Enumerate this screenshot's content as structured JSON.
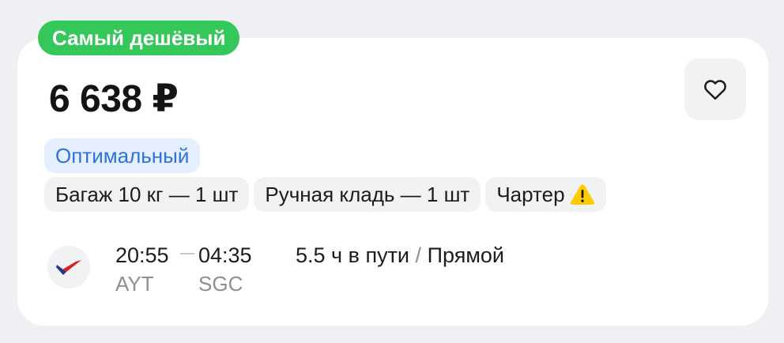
{
  "badge": {
    "label": "Самый дешёвый",
    "color": "#34c759"
  },
  "price": {
    "label": "6 638 ₽"
  },
  "favorite": {
    "icon": "heart-outline-icon"
  },
  "fare": {
    "label": "Оптимальный",
    "color": "#2f72d8"
  },
  "features": {
    "items": [
      {
        "label": "Багаж 10 кг — 1 шт"
      },
      {
        "label": "Ручная кладь — 1 шт"
      },
      {
        "label": "Чартер",
        "icon": "warning-icon",
        "icon_color": "#ffcc00"
      }
    ]
  },
  "flight": {
    "airline_logo": "airline-logo",
    "departure": {
      "time": "20:55",
      "airport": "AYT"
    },
    "arrival": {
      "time": "04:35",
      "airport": "SGC"
    },
    "duration": "5.5 ч в пути",
    "separator": "/",
    "type": "Прямой"
  }
}
